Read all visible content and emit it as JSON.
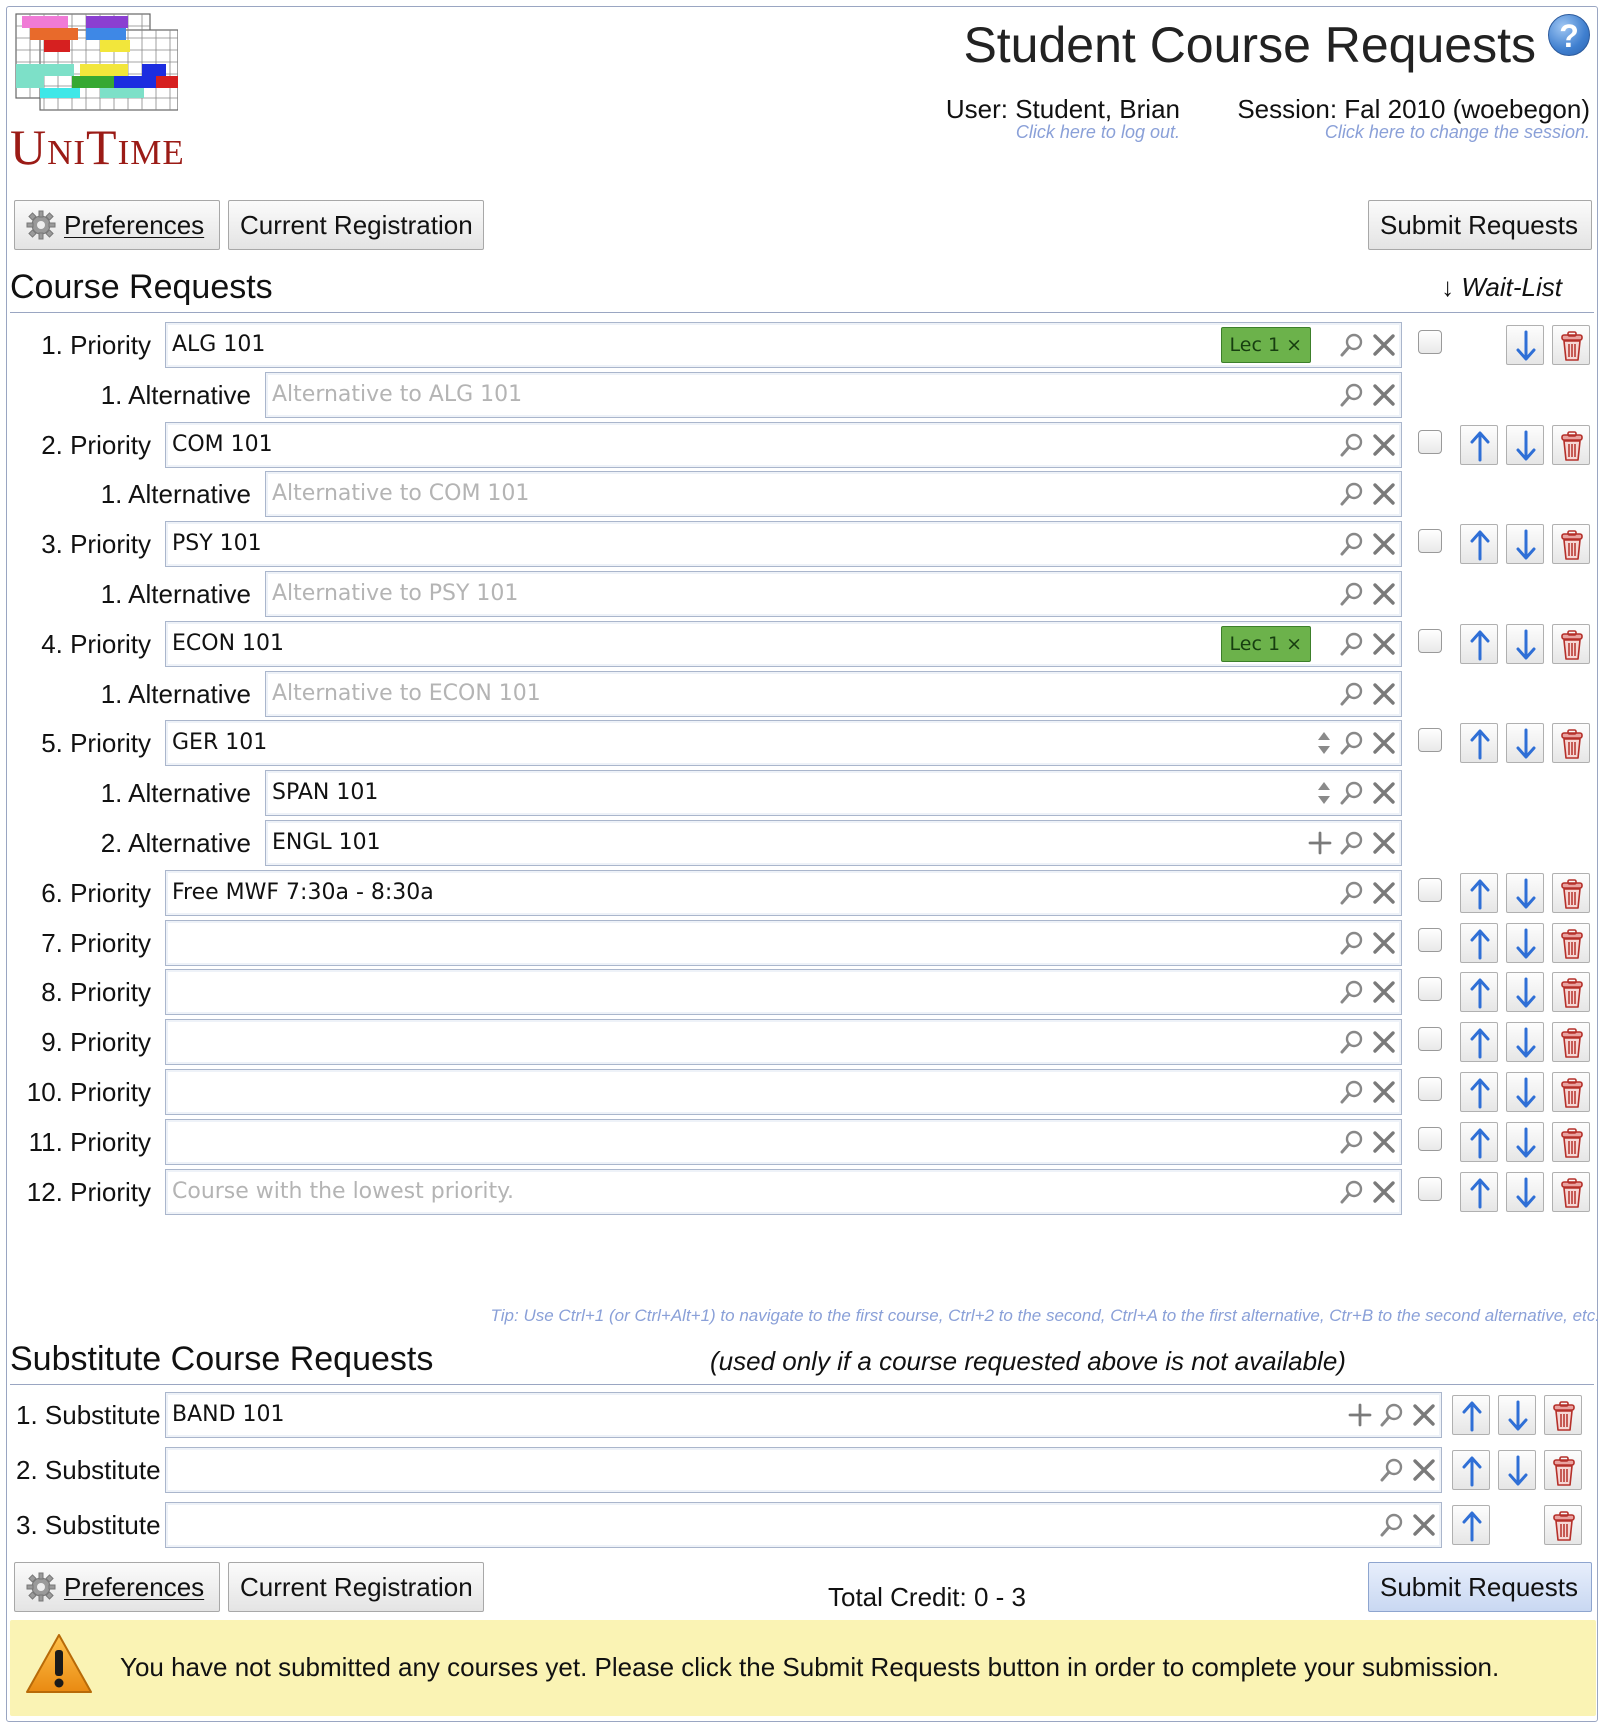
{
  "app": {
    "logo_text": "UniTime",
    "title": "Student Course Requests",
    "help_icon": "help-icon",
    "user_label": "User: Student, Brian",
    "user_hint": "Click here to log out.",
    "session_label": "Session: Fal 2010 (woebegon)",
    "session_hint": "Click here to change the session."
  },
  "toolbar": {
    "preferences_label": "Preferences",
    "current_registration_label": "Current Registration",
    "submit_label": "Submit Requests"
  },
  "course_requests": {
    "heading": "Course Requests",
    "waitlist_header": "↓ Wait-List",
    "rows": [
      {
        "label": "1. Priority",
        "value": "ALG 101",
        "chip": "Lec 1 ×"
      },
      {
        "label": "1. Alternative",
        "placeholder": "Alternative to ALG 101"
      },
      {
        "label": "2. Priority",
        "value": "COM 101"
      },
      {
        "label": "1. Alternative",
        "placeholder": "Alternative to COM 101"
      },
      {
        "label": "3. Priority",
        "value": "PSY 101"
      },
      {
        "label": "1. Alternative",
        "placeholder": "Alternative to PSY 101"
      },
      {
        "label": "4. Priority",
        "value": "ECON 101",
        "chip": "Lec 1 ×"
      },
      {
        "label": "1. Alternative",
        "placeholder": "Alternative to ECON 101"
      },
      {
        "label": "5. Priority",
        "value": "GER 101"
      },
      {
        "label": "1. Alternative",
        "value": "SPAN 101"
      },
      {
        "label": "2. Alternative",
        "value": "ENGL 101"
      },
      {
        "label": "6. Priority",
        "value": "Free MWF 7:30a - 8:30a"
      },
      {
        "label": "7. Priority",
        "value": ""
      },
      {
        "label": "8. Priority",
        "value": ""
      },
      {
        "label": "9. Priority",
        "value": ""
      },
      {
        "label": "10. Priority",
        "value": ""
      },
      {
        "label": "11. Priority",
        "value": ""
      },
      {
        "label": "12. Priority",
        "placeholder": "Course with the lowest priority."
      }
    ],
    "tip": "Tip: Use Ctrl+1 (or Ctrl+Alt+1) to navigate to the first course, Ctrl+2 to the second, Ctrl+A to the first alternative, Ctr+B to the second alternative, etc."
  },
  "substitutes": {
    "heading": "Substitute Course Requests",
    "note": "(used only if a course requested above is not available)",
    "rows": [
      {
        "label": "1. Substitute",
        "value": "BAND 101"
      },
      {
        "label": "2. Substitute",
        "value": ""
      },
      {
        "label": "3. Substitute",
        "value": ""
      }
    ]
  },
  "footer": {
    "total_credit": "Total Credit: 0 - 3",
    "warning": "You have not submitted any courses yet. Please click the Submit Requests button in order to complete your submission."
  },
  "icons": {
    "search": "search-icon",
    "clear": "clear-icon",
    "add": "plus-icon",
    "swap": "updown-icon",
    "move_up": "arrow-up-icon",
    "move_down": "arrow-down-icon",
    "delete": "trash-icon",
    "warning": "warning-icon",
    "settings": "gear-icon"
  },
  "colors": {
    "chip_green": "#6cb24b",
    "arrow_blue": "#2f6fd6",
    "trash_red": "#c0392b",
    "hint_blue": "#8aa0d8",
    "warn_bg": "#faf3b4"
  }
}
